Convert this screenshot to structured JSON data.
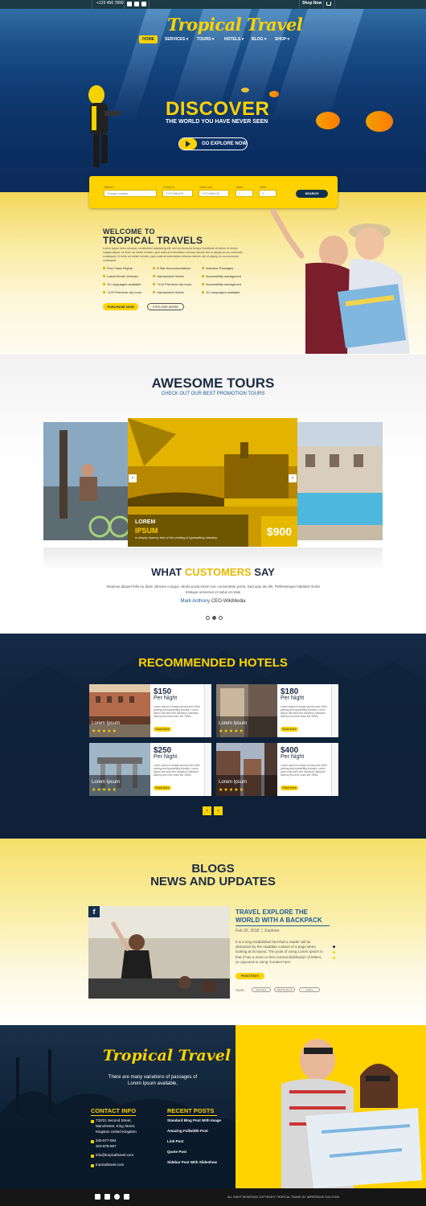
{
  "colors": {
    "accent": "#ffd200",
    "navy": "#12314f",
    "blue": "#1b5a9a",
    "dark": "#1d2c44"
  },
  "topbar": {
    "phone": "+123 456 7890",
    "shop_now": "Shop Now",
    "social_icons": [
      "facebook-icon",
      "instagram-icon",
      "twitter-icon"
    ]
  },
  "brand": {
    "logo": "Tropical Travel"
  },
  "nav": {
    "items": [
      "HOME",
      "SERVICES ▾",
      "TOURS ▾",
      "HOTELS ▾",
      "BLOG ▾",
      "SHOP ▾"
    ]
  },
  "hero": {
    "title": "DISCOVER",
    "subtitle": "THE WORLD YOU HAVE NEVER SEEN",
    "button": "GO EXPLORE NOW"
  },
  "search": {
    "fields": [
      {
        "label": "Where?",
        "placeholder": "Choose Location"
      },
      {
        "label": "Check in",
        "placeholder": "YYYY-MM-DD"
      },
      {
        "label": "Check out",
        "placeholder": "YYYY-MM-DD"
      },
      {
        "label": "Adult",
        "placeholder": "1"
      },
      {
        "label": "Child",
        "placeholder": "0"
      }
    ],
    "button": "SEARCH"
  },
  "welcome": {
    "title1": "WELCOME TO",
    "title2": "TROPICAL TRAVELS",
    "text": "Lorem ipsum dolor sit amet, consectetur adipiscing elit, sed do eiusmod tempor incididunt ut labore et dolore magna aliqua. Ut enim ad minim veniam, quis nostrud exercitation ullamco laboris nisi ut aliquip ex ea commodo consequat. Ut enim ad minim veniam, quis nostrud exercitation ullamco laboris nisi ut aliquip ex ea commodo consequat.",
    "features_left": [
      "First Class Flights",
      "Latest Model Vehicles",
      "10 Languages available",
      "+120 Premium city tours"
    ],
    "features_mid": [
      "5 Star Accommodations",
      "Handpicked Hotels",
      "+120 Premium city tours",
      "Handpicked Hotels"
    ],
    "features_right": [
      "Inclusive Packages",
      "Accessibility managment",
      "Accessibility managment",
      "10 Languages available"
    ],
    "purchase": "PURCHASE NOW",
    "explore": "EXPLORE MORE"
  },
  "tours": {
    "title": "AWESOME TOURS",
    "subtitle": "CHECK OUT OUR BEST PROMOTION TOURS",
    "card_label1": "LOREM",
    "card_label2": "IPSUM",
    "card_sub": "is simply dummy text of the printing & typesetting industry.",
    "price": "$900"
  },
  "customers": {
    "title_a": "WHAT",
    "title_b": "CUSTOMERS",
    "title_c": "SAY",
    "text": "Vivamus aliquet felis eu diam ultricies congue. Morbi porta lorem nec consectetur porta. Sed quis dui elit. Pellentesque habitant morbi tristique senectus et netus et male",
    "name": "Mark Anthony",
    "role": "CEO-WikiMedia"
  },
  "hotels": {
    "title": "RECOMMENDED HOTELS",
    "cards": [
      {
        "price": "$150",
        "per": "Per Night",
        "name": "Lorem Ipsum",
        "stars": "★★★★★",
        "read": "Read More"
      },
      {
        "price": "$180",
        "per": "Per Night",
        "name": "Lorem Ipsum",
        "stars": "★★★★★",
        "read": "Read More"
      },
      {
        "price": "$250",
        "per": "Per Night",
        "name": "Lorem Ipsum",
        "stars": "★★★★★",
        "read": "Read More"
      },
      {
        "price": "$400",
        "per": "Per Night",
        "name": "Lorem Ipsum",
        "stars": "★★★★★",
        "read": "Read More"
      }
    ],
    "card_text": "Lorem Ipsum is simply dummy text of the printing and typesetting industry. Lorem Ipsum has been the industry's standard dummy text ever since the 1500s"
  },
  "blogs": {
    "title1": "BLOGS",
    "title2": "NEWS AND UPDATES",
    "post_title1": "TRAVEL EXPLORE THE",
    "post_title2": "WORLD WITH A BACKPACK",
    "date": "Feb 20, 2018",
    "category": "Explorer",
    "text": "It is a long established fact that a reader will be distracted by the readable content of a page when looking at its layout. The point of using Lorem Ipsum is that it has a more-or-less normal distribution of letters, as opposed to using 'Content here",
    "read": "Read More",
    "tags_label": "TAGS :",
    "tags": [
      "Adventure",
      "Adult Perfume",
      "Insane"
    ]
  },
  "footer": {
    "logo": "Tropical Travel",
    "tagline1": "There are many variations of passages of",
    "tagline2": "Lorem Ipsum available,",
    "contact_title": "CONTACT INFO",
    "address1": "732/21 Second Street,",
    "address2": "Manchester, King Street,",
    "address3": "Kingston United Kingdom",
    "phone1": "345-677-554",
    "phone2": "323-678-567",
    "email": "info@tropicaltravel.com",
    "website": "tropicaltravel.com",
    "recent_title": "RECENT POSTS",
    "posts": [
      "Standard Blog Post With Image",
      "Amazing Fullwidth Post",
      "Link Post",
      "Quote Post",
      "Sidebar Post With Slideshow"
    ],
    "copyright": "ALL RIGHT RESERVED COPYRIGHT TROPICAL TRAVEL BY IMPRESSIVE SOLUTION"
  }
}
